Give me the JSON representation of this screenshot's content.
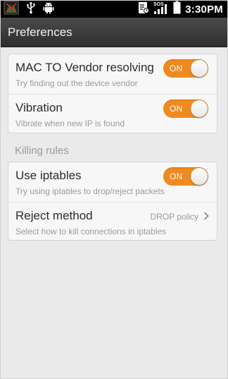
{
  "status_bar": {
    "time": "3:30PM",
    "left_icons": [
      "app-notification-icon",
      "usb-icon",
      "android-debug-icon"
    ],
    "right_icons": [
      "notification-icon",
      "sos-signal-icon",
      "battery-icon"
    ],
    "sos_label": "SOS"
  },
  "action_bar": {
    "title": "Preferences"
  },
  "settings": {
    "mac_vendor": {
      "title": "MAC TO Vendor resolving",
      "subtitle": "Try finding out the device vendor",
      "toggle_label": "ON"
    },
    "vibration": {
      "title": "Vibration",
      "subtitle": "Vibrate when new IP is found",
      "toggle_label": "ON"
    },
    "killing_rules_header": "Killing rules",
    "use_iptables": {
      "title": "Use iptables",
      "subtitle": "Try using iptables to drop/reject packets",
      "toggle_label": "ON"
    },
    "reject_method": {
      "title": "Reject method",
      "subtitle": "Select how to kill connections in iptables",
      "value": "DROP policy"
    }
  },
  "colors": {
    "toggle_on": "#f08a1f",
    "action_bar": "#3a3a3a",
    "status_bar": "#000000"
  }
}
